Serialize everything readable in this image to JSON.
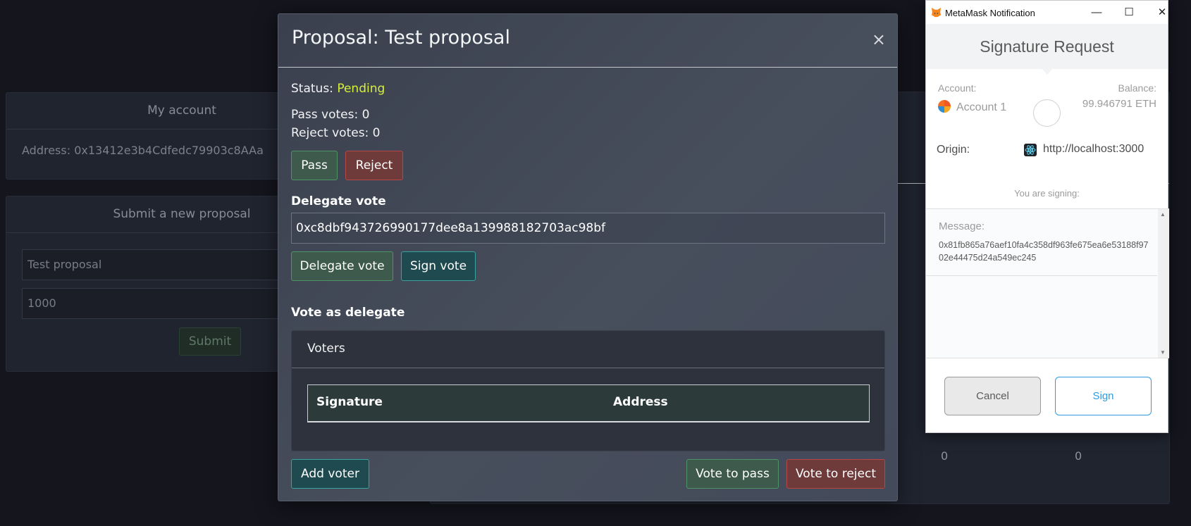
{
  "background": {
    "account_title": "My account",
    "address_label": "Address: 0x13412e3b4Cdfedc79903c8AAa",
    "proposal_title": "Submit a new proposal",
    "proposal_name_value": "Test proposal",
    "proposal_amount_value": "1000",
    "submit_label": "Submit",
    "zero_a": "0",
    "zero_b": "0"
  },
  "modal": {
    "title": "Proposal: Test proposal",
    "close_glyph": "×",
    "status_label": "Status:",
    "status_value": "Pending",
    "pass_votes": "Pass votes: 0",
    "reject_votes": "Reject votes: 0",
    "pass_label": "Pass",
    "reject_label": "Reject",
    "delegate_title": "Delegate vote",
    "delegate_value": "0xc8dbf943726990177dee8a139988182703ac98bf",
    "delegate_button": "Delegate vote",
    "sign_vote_button": "Sign vote",
    "vote_as_delegate_title": "Vote as delegate",
    "voters_title": "Voters",
    "voters_columns": [
      "Signature",
      "Address"
    ],
    "add_voter_button": "Add voter",
    "vote_pass_button": "Vote to pass",
    "vote_reject_button": "Vote to reject"
  },
  "metamask": {
    "window_title": "MetaMask Notification",
    "header_title": "Signature Request",
    "account_label": "Account:",
    "account_name": "Account 1",
    "balance_label": "Balance:",
    "balance_value": "99.946791 ETH",
    "origin_label": "Origin:",
    "origin_value": "http://localhost:3000",
    "signing_label": "You are signing:",
    "message_label": "Message:",
    "message_value": "0x81fb865a76aef10fa4c358df963fe675ea6e53188f9702e44475d24a549ec245",
    "cancel_label": "Cancel",
    "sign_label": "Sign"
  },
  "colors": {
    "status_pending": "#d6ef3a",
    "accent_green": "#4f9466",
    "accent_red": "#b54747",
    "accent_teal": "#3aa3a0",
    "metamask_blue": "#2f9ae0"
  }
}
